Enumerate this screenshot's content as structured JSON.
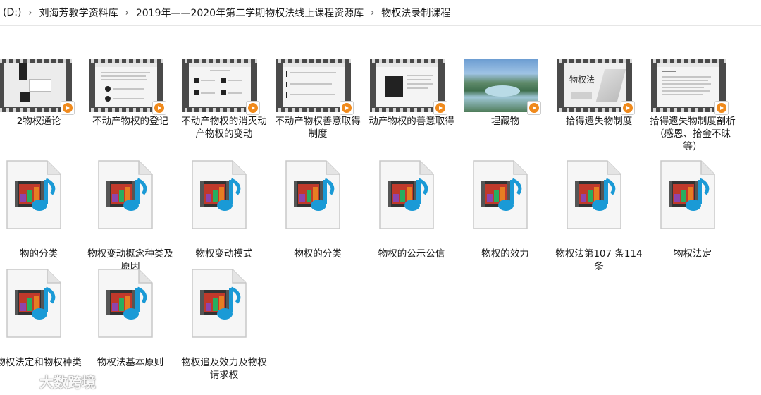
{
  "breadcrumb": [
    "(D:)",
    "刘海芳教学资料库",
    "2019年——2020年第二学期物权法线上课程资源库",
    "物权法录制课程"
  ],
  "separator": "›",
  "videos": [
    {
      "label": "2物权通论",
      "thumb": "screenshot-app"
    },
    {
      "label": "不动产物权的登记",
      "thumb": "slide-text"
    },
    {
      "label": "不动产物权的消灭动产物权的变动",
      "thumb": "slide-grid"
    },
    {
      "label": "不动产物权善意取得制度",
      "thumb": "slide-bullets"
    },
    {
      "label": "动产物权的善意取得",
      "thumb": "slide-dark-box"
    },
    {
      "label": "埋藏物",
      "thumb": "landscape-photo"
    },
    {
      "label": "拾得遗失物制度",
      "thumb": "title-slide"
    },
    {
      "label": "拾得遗失物制度剖析（感恩、拾金不昧等）",
      "thumb": "slide-text2"
    }
  ],
  "media_files": [
    {
      "label": "物的分类"
    },
    {
      "label": "物权变动概念种类及原因"
    },
    {
      "label": "物权变动模式"
    },
    {
      "label": "物权的分类"
    },
    {
      "label": "物权的公示公信"
    },
    {
      "label": "物权的效力"
    },
    {
      "label": "物权法第107 条114条"
    },
    {
      "label": "物权法定"
    },
    {
      "label": "物权法定和物权种类"
    },
    {
      "label": "物权法基本原则"
    },
    {
      "label": "物权追及效力及物权请求权"
    }
  ],
  "title_slide_text": "物权法",
  "watermark": "大数跨境",
  "colors": {
    "play": "#f08a1c",
    "note": "#1a9ad6",
    "film": "#4a4a4a"
  }
}
